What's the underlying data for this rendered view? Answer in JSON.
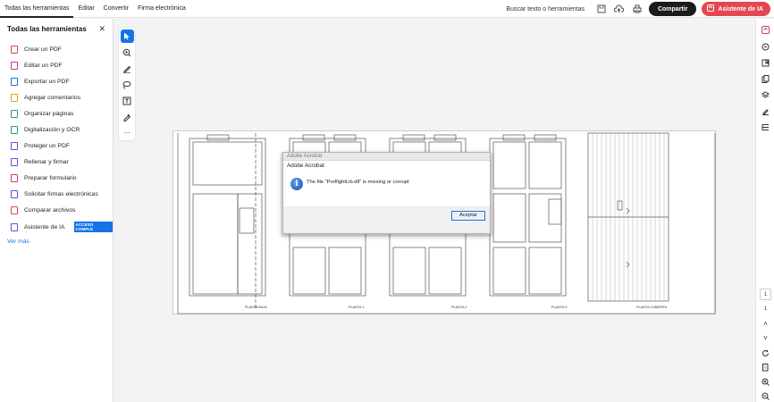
{
  "menu": [
    "Todas las herramientas",
    "Editar",
    "Convertir",
    "Firma electrónica"
  ],
  "search_label": "Buscar texto o herramientas",
  "share_label": "Compartir",
  "ai_label": "Asistente de IA",
  "sidebar": {
    "title": "Todas las herramientas",
    "items": [
      {
        "label": "Crear un PDF",
        "color": "#e34850"
      },
      {
        "label": "Editar un PDF",
        "color": "#c73b8f"
      },
      {
        "label": "Exportar un PDF",
        "color": "#1473e6"
      },
      {
        "label": "Agregar comentarios",
        "color": "#e9a100"
      },
      {
        "label": "Organizar páginas",
        "color": "#2d9d78"
      },
      {
        "label": "Digitalización y OCR",
        "color": "#2d9d78"
      },
      {
        "label": "Proteger un PDF",
        "color": "#6e4bd8"
      },
      {
        "label": "Rellenar y firmar",
        "color": "#6e4bd8"
      },
      {
        "label": "Preparar formulario",
        "color": "#c73b8f"
      },
      {
        "label": "Solicitar firmas electrónicas",
        "color": "#6e4bd8"
      },
      {
        "label": "Comparar archivos",
        "color": "#e34850"
      },
      {
        "label": "Asistente de IA",
        "color": "#6e4bd8",
        "badge": "ACCESO COMPLE"
      }
    ],
    "more": "Ver más"
  },
  "drawing": {
    "labels": [
      "PLANTA BAJA",
      "PLANTA 1",
      "PLANTA 2",
      "PLANTA 3",
      "PLANTA CUBIERTA"
    ]
  },
  "dialog": {
    "window_title": "Adobe Acrobat",
    "title": "Adobe Acrobat",
    "message": "The file \"PreflightLib.dll\" is missing or corrupt",
    "ok_label": "Aceptar"
  }
}
